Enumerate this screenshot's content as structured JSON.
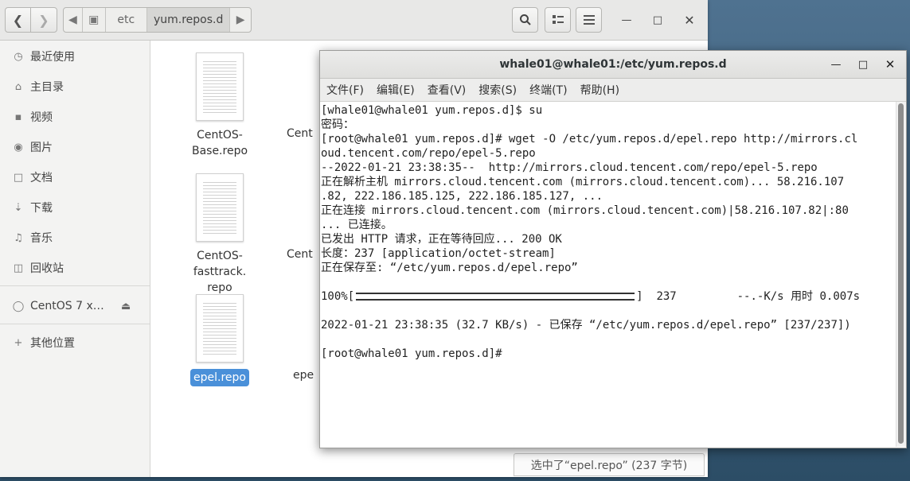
{
  "file_manager": {
    "path": [
      "etc",
      "yum.repos.d"
    ],
    "sidebar": [
      {
        "label": "最近使用",
        "icon": "clock-icon"
      },
      {
        "label": "主目录",
        "icon": "home-icon"
      },
      {
        "label": "视频",
        "icon": "video-icon"
      },
      {
        "label": "图片",
        "icon": "camera-icon"
      },
      {
        "label": "文档",
        "icon": "document-icon"
      },
      {
        "label": "下载",
        "icon": "download-icon"
      },
      {
        "label": "音乐",
        "icon": "music-icon"
      },
      {
        "label": "回收站",
        "icon": "trash-icon"
      }
    ],
    "device": {
      "label": "CentOS 7 x…",
      "icon": "disc-icon"
    },
    "other": {
      "label": "其他位置",
      "icon": "plus-icon"
    },
    "files": [
      {
        "name": "CentOS-Base.repo"
      },
      {
        "name": "Cent"
      },
      {
        "name": "CentOS-fasttrack.",
        "name2": "repo"
      },
      {
        "name": "Cent"
      },
      {
        "name": "epel.repo"
      },
      {
        "name": "epe"
      }
    ],
    "status": "选中了“epel.repo” (237 字节)"
  },
  "terminal": {
    "title": "whale01@whale01:/etc/yum.repos.d",
    "menu": [
      "文件(F)",
      "编辑(E)",
      "查看(V)",
      "搜索(S)",
      "终端(T)",
      "帮助(H)"
    ],
    "lines": [
      "[whale01@whale01 yum.repos.d]$ su",
      "密码：",
      "[root@whale01 yum.repos.d]# wget -O /etc/yum.repos.d/epel.repo http://mirrors.cl",
      "oud.tencent.com/repo/epel-5.repo",
      "--2022-01-21 23:38:35--  http://mirrors.cloud.tencent.com/repo/epel-5.repo",
      "正在解析主机 mirrors.cloud.tencent.com (mirrors.cloud.tencent.com)... 58.216.107",
      ".82, 222.186.185.125, 222.186.185.127, ...",
      "正在连接 mirrors.cloud.tencent.com (mirrors.cloud.tencent.com)|58.216.107.82|:80",
      "... 已连接。",
      "已发出 HTTP 请求，正在等待回应... 200 OK",
      "长度：237 [application/octet-stream]",
      "正在保存至: “/etc/yum.repos.d/epel.repo”",
      "",
      "",
      "",
      "2022-01-21 23:38:35 (32.7 KB/s) - 已保存 “/etc/yum.repos.d/epel.repo” [237/237])",
      "",
      "[root@whale01 yum.repos.d]# "
    ],
    "progress": {
      "pct_label": "100%",
      "fraction": 1.0,
      "size": "237",
      "speed": "--.-K/s",
      "eta_label": "用时",
      "eta": "0.007s"
    }
  }
}
